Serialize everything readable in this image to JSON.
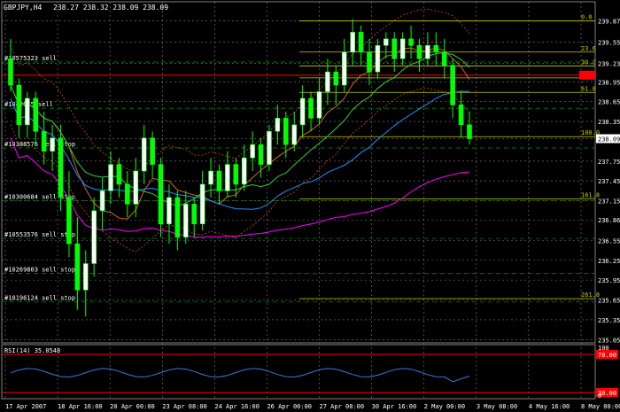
{
  "header": {
    "symbol": "GBPJPY,H4",
    "ohlc": "238.27 238.32 238.09 238.09"
  },
  "colors": {
    "background": "#000000",
    "grid": "#808080",
    "bull": "#ffffff",
    "bear": "#00ff00",
    "fib": "#c8c800",
    "order_line": "#008000",
    "price_box": "#ff0000",
    "ma_blue": "#1e90ff",
    "ma_magenta": "#ff00ff",
    "ma_orange": "#d2691e",
    "ma_green": "#32cd32",
    "bollinger": "#c8501e",
    "rsi_line": "#3c78d8",
    "rsi_level": "#ff0000"
  },
  "chart_data": {
    "type": "candlestick",
    "y_range": [
      235.0,
      240.0
    ],
    "price_ticks": [
      "239.87",
      "239.55",
      "239.23",
      "238.95",
      "238.65",
      "238.35",
      "238.09",
      "237.75",
      "237.45",
      "237.15",
      "236.86",
      "236.55",
      "236.25",
      "235.95",
      "235.65",
      "235.35",
      "235.05"
    ],
    "current_price": "238.09",
    "red_boxes": [
      {
        "label": "239.??",
        "value": 239.05
      }
    ],
    "x_labels": [
      "17 Apr 2007",
      "18 Apr 16:00",
      "20 Apr 00:00",
      "23 Apr 08:00",
      "24 Apr 16:00",
      "26 Apr 00:00",
      "27 Apr 08:00",
      "30 Apr 16:00",
      "2 May 00:00",
      "3 May 08:00",
      "4 May 16:00",
      "8 May 00:00"
    ],
    "fib_levels": [
      {
        "label": "0.0",
        "price": 239.87
      },
      {
        "label": "23.6",
        "price": 239.4
      },
      {
        "label": "38.2",
        "price": 239.19
      },
      {
        "label": "50.0",
        "price": 239.01
      },
      {
        "label": "61.8",
        "price": 238.79
      },
      {
        "label": "100.0",
        "price": 238.12
      },
      {
        "label": "161.8",
        "price": 237.18
      },
      {
        "label": "261.8",
        "price": 235.67
      }
    ],
    "orders": [
      {
        "label": "#10575323 sell",
        "price": 239.25
      },
      {
        "label": "#1042075 sell",
        "price": 238.55
      },
      {
        "label": "#10388576 sell stop",
        "price": 237.95
      },
      {
        "label": "#10300684 sell stop",
        "price": 237.15
      },
      {
        "label": "#10553576 sell stop",
        "price": 236.58
      },
      {
        "label": "#10269803 sell stop",
        "price": 236.05
      },
      {
        "label": "#10196124 sell stop",
        "price": 235.62
      }
    ],
    "candles": [
      [
        239.3,
        239.6,
        238.8,
        238.9
      ],
      [
        238.9,
        239.0,
        238.1,
        238.3
      ],
      [
        238.3,
        238.8,
        238.1,
        238.7
      ],
      [
        238.7,
        238.8,
        238.0,
        238.2
      ],
      [
        238.2,
        238.5,
        237.7,
        237.9
      ],
      [
        237.9,
        238.3,
        237.6,
        238.1
      ],
      [
        238.1,
        238.3,
        237.0,
        237.2
      ],
      [
        237.2,
        237.6,
        236.3,
        236.5
      ],
      [
        236.5,
        236.9,
        235.5,
        235.8
      ],
      [
        235.8,
        236.4,
        235.4,
        236.2
      ],
      [
        236.2,
        237.2,
        236.0,
        237.0
      ],
      [
        237.0,
        237.5,
        236.7,
        237.3
      ],
      [
        237.3,
        237.9,
        237.1,
        237.7
      ],
      [
        237.7,
        237.8,
        237.2,
        237.4
      ],
      [
        237.4,
        237.6,
        236.9,
        237.1
      ],
      [
        237.1,
        237.8,
        236.9,
        237.6
      ],
      [
        237.6,
        238.3,
        237.4,
        238.1
      ],
      [
        238.1,
        238.2,
        237.5,
        237.7
      ],
      [
        237.7,
        237.8,
        236.6,
        236.8
      ],
      [
        236.8,
        237.4,
        236.5,
        237.2
      ],
      [
        237.2,
        237.3,
        236.4,
        236.6
      ],
      [
        236.6,
        237.3,
        236.5,
        237.1
      ],
      [
        237.1,
        237.2,
        236.6,
        236.8
      ],
      [
        236.8,
        237.6,
        236.7,
        237.4
      ],
      [
        237.4,
        237.8,
        237.2,
        237.6
      ],
      [
        237.6,
        237.7,
        237.1,
        237.3
      ],
      [
        237.3,
        237.9,
        237.2,
        237.7
      ],
      [
        237.7,
        237.8,
        237.2,
        237.4
      ],
      [
        237.4,
        238.0,
        237.3,
        237.8
      ],
      [
        237.8,
        238.2,
        237.6,
        238.0
      ],
      [
        238.0,
        238.1,
        237.5,
        237.7
      ],
      [
        237.7,
        238.3,
        237.6,
        238.2
      ],
      [
        238.2,
        238.6,
        238.0,
        238.4
      ],
      [
        238.4,
        238.5,
        237.8,
        238.0
      ],
      [
        238.0,
        238.5,
        237.9,
        238.3
      ],
      [
        238.3,
        238.9,
        238.1,
        238.7
      ],
      [
        238.7,
        238.8,
        238.2,
        238.4
      ],
      [
        238.4,
        239.0,
        238.3,
        238.8
      ],
      [
        238.8,
        239.3,
        238.6,
        239.1
      ],
      [
        239.1,
        239.2,
        238.6,
        238.9
      ],
      [
        238.9,
        239.6,
        238.8,
        239.4
      ],
      [
        239.4,
        239.9,
        239.2,
        239.7
      ],
      [
        239.7,
        239.8,
        239.2,
        239.4
      ],
      [
        239.4,
        239.6,
        238.9,
        239.1
      ],
      [
        239.1,
        239.6,
        239.0,
        239.5
      ],
      [
        239.5,
        239.7,
        239.3,
        239.6
      ],
      [
        239.6,
        239.7,
        239.1,
        239.3
      ],
      [
        239.3,
        239.7,
        239.2,
        239.6
      ],
      [
        239.6,
        239.8,
        239.3,
        239.5
      ],
      [
        239.5,
        239.6,
        239.1,
        239.3
      ],
      [
        239.3,
        239.7,
        239.2,
        239.5
      ],
      [
        239.5,
        239.7,
        239.2,
        239.4
      ],
      [
        239.4,
        239.6,
        239.0,
        239.2
      ],
      [
        239.2,
        239.3,
        238.4,
        238.6
      ],
      [
        238.6,
        238.8,
        238.1,
        238.3
      ],
      [
        238.3,
        238.5,
        238.0,
        238.09
      ]
    ],
    "indicator": {
      "label": "RSI(14) 35.0548",
      "levels": [
        "70.00",
        "30.00"
      ],
      "scale": [
        "100",
        "0"
      ]
    }
  }
}
